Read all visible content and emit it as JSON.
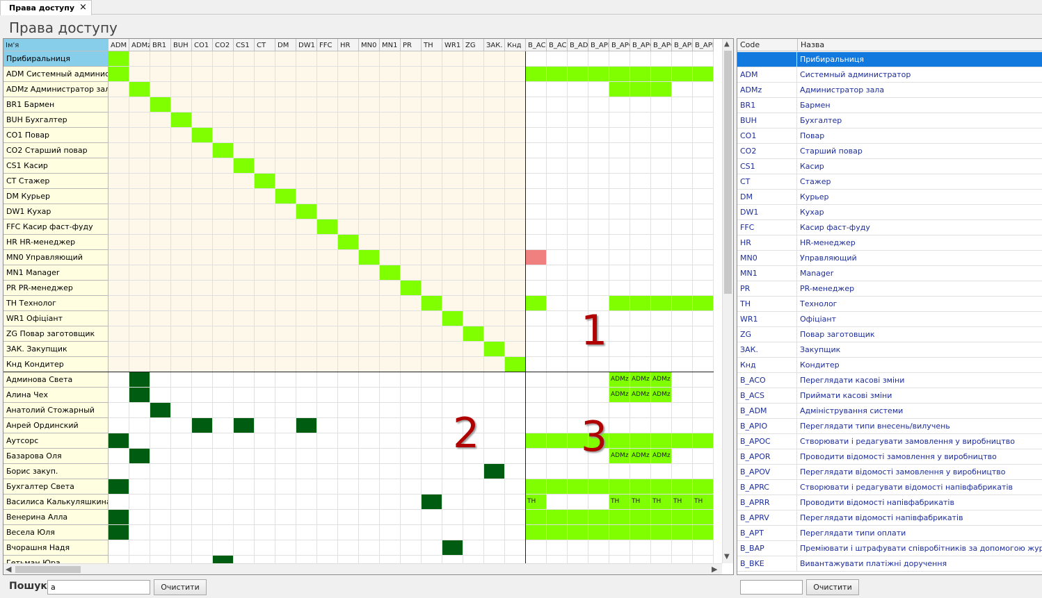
{
  "tab": {
    "title": "Права доступу",
    "close": "×"
  },
  "page_title": "Права доступу",
  "colors": {
    "light_green": "#7fff00",
    "dark_green": "#005c10",
    "pink": "#f08080",
    "cream": "#fdf8e9",
    "name_yellow": "#fffee0",
    "selected": "#1279de",
    "header_blue": "#87ceeb"
  },
  "matrix": {
    "name_header": "Ім'я",
    "columns": [
      "ADM",
      "ADMz",
      "BR1",
      "BUH",
      "CO1",
      "CO2",
      "CS1",
      "CT",
      "DM",
      "DW1",
      "FFC",
      "HR",
      "MN0",
      "MN1",
      "PR",
      "TH",
      "WR1",
      "ZG",
      "ЗАК.",
      "Кнд",
      "B_ACO",
      "B_ACS",
      "B_ADM",
      "B_APIO",
      "B_APOC",
      "B_APOR",
      "B_APOV",
      "B_APRC",
      "B_APRR"
    ],
    "roles": [
      "Прибиральниця",
      "ADM Системный администратор",
      "ADMz Администратор зала",
      "BR1 Бармен",
      "BUH Бухгалтер",
      "CO1 Повар",
      "CO2 Старший повар",
      "CS1 Касир",
      "CT Стажер",
      "DM Курьер",
      "DW1 Кухар",
      "FFC Касир фаст-фуду",
      "HR HR-менеджер",
      "MN0 Управляющий",
      "MN1 Manager",
      "PR PR-менеджер",
      "TH Технолог",
      "WR1 Офіціант",
      "ZG Повар заготовщик",
      "ЗАК. Закупщик",
      "Кнд Кондитер"
    ],
    "users": [
      "Админова Света",
      "Алина Чех",
      "Анатолий Стожарный",
      "Анрей Ординский",
      "Аутсорс",
      "Базарова Оля",
      "Борис закуп.",
      "Бухгалтер Света",
      "Василиса Калькуляшкина",
      "Венерина Алла",
      "Весела Юля",
      "Вчорашня Надя",
      "Гетьман Юра"
    ],
    "role_perm_cells": [
      [
        1,
        20
      ],
      [
        1,
        21
      ],
      [
        1,
        22
      ],
      [
        1,
        23
      ],
      [
        1,
        24
      ],
      [
        1,
        25
      ],
      [
        1,
        26
      ],
      [
        1,
        27
      ],
      [
        1,
        28
      ],
      [
        2,
        24
      ],
      [
        2,
        25
      ],
      [
        2,
        26
      ],
      [
        16,
        20
      ],
      [
        16,
        24
      ],
      [
        16,
        25
      ],
      [
        16,
        26
      ],
      [
        16,
        27
      ],
      [
        16,
        28
      ]
    ],
    "role_perm_pink": [
      [
        13,
        20
      ]
    ],
    "user_role_cells": [
      [
        0,
        1
      ],
      [
        1,
        1
      ],
      [
        2,
        2
      ],
      [
        3,
        4
      ],
      [
        3,
        6
      ],
      [
        3,
        9
      ],
      [
        4,
        0
      ],
      [
        5,
        1
      ],
      [
        6,
        18
      ],
      [
        7,
        0
      ],
      [
        8,
        15
      ],
      [
        9,
        0
      ],
      [
        10,
        0
      ],
      [
        11,
        16
      ],
      [
        12,
        5
      ]
    ],
    "user_perm_cells": [
      [
        0,
        24,
        "ADMz"
      ],
      [
        0,
        25,
        "ADMz"
      ],
      [
        0,
        26,
        "ADMz"
      ],
      [
        1,
        24,
        "ADMz"
      ],
      [
        1,
        25,
        "ADMz"
      ],
      [
        1,
        26,
        "ADMz"
      ],
      [
        4,
        20,
        ""
      ],
      [
        4,
        21,
        ""
      ],
      [
        4,
        22,
        ""
      ],
      [
        4,
        23,
        ""
      ],
      [
        4,
        24,
        ""
      ],
      [
        4,
        25,
        ""
      ],
      [
        4,
        26,
        ""
      ],
      [
        4,
        27,
        ""
      ],
      [
        4,
        28,
        ""
      ],
      [
        5,
        24,
        "ADMz"
      ],
      [
        5,
        25,
        "ADMz"
      ],
      [
        5,
        26,
        "ADMz"
      ],
      [
        7,
        20,
        ""
      ],
      [
        7,
        21,
        ""
      ],
      [
        7,
        22,
        ""
      ],
      [
        7,
        23,
        ""
      ],
      [
        7,
        24,
        ""
      ],
      [
        7,
        25,
        ""
      ],
      [
        7,
        26,
        ""
      ],
      [
        7,
        27,
        ""
      ],
      [
        7,
        28,
        ""
      ],
      [
        8,
        20,
        "TH"
      ],
      [
        8,
        24,
        "TH"
      ],
      [
        8,
        25,
        "TH"
      ],
      [
        8,
        26,
        "TH"
      ],
      [
        8,
        27,
        "TH"
      ],
      [
        8,
        28,
        "TH"
      ],
      [
        9,
        20,
        ""
      ],
      [
        9,
        21,
        ""
      ],
      [
        9,
        22,
        ""
      ],
      [
        9,
        23,
        ""
      ],
      [
        9,
        24,
        ""
      ],
      [
        9,
        25,
        ""
      ],
      [
        9,
        26,
        ""
      ],
      [
        9,
        27,
        ""
      ],
      [
        9,
        28,
        ""
      ],
      [
        10,
        20,
        ""
      ],
      [
        10,
        21,
        ""
      ],
      [
        10,
        22,
        ""
      ],
      [
        10,
        23,
        ""
      ],
      [
        10,
        24,
        ""
      ],
      [
        10,
        25,
        ""
      ],
      [
        10,
        26,
        ""
      ],
      [
        10,
        27,
        ""
      ],
      [
        10,
        28,
        ""
      ]
    ]
  },
  "annotations": [
    "1",
    "2",
    "3"
  ],
  "scroll": {
    "up": "▲",
    "down": "▼",
    "left": "◀",
    "right": "▶"
  },
  "right_table": {
    "headers": {
      "code": "Code",
      "name": "Назва"
    },
    "rows": [
      {
        "code": "",
        "name": "Прибиральниця"
      },
      {
        "code": "ADM",
        "name": "Системный администратор"
      },
      {
        "code": "ADMz",
        "name": "Администратор зала"
      },
      {
        "code": "BR1",
        "name": "Бармен"
      },
      {
        "code": "BUH",
        "name": "Бухгалтер"
      },
      {
        "code": "CO1",
        "name": "Повар"
      },
      {
        "code": "CO2",
        "name": "Старший повар"
      },
      {
        "code": "CS1",
        "name": "Касир"
      },
      {
        "code": "CT",
        "name": "Стажер"
      },
      {
        "code": "DM",
        "name": "Курьер"
      },
      {
        "code": "DW1",
        "name": "Кухар"
      },
      {
        "code": "FFC",
        "name": "Касир фаст-фуду"
      },
      {
        "code": "HR",
        "name": "HR-менеджер"
      },
      {
        "code": "MN0",
        "name": "Управляющий"
      },
      {
        "code": "MN1",
        "name": "Manager"
      },
      {
        "code": "PR",
        "name": "PR-менеджер"
      },
      {
        "code": "TH",
        "name": "Технолог"
      },
      {
        "code": "WR1",
        "name": "Офіціант"
      },
      {
        "code": "ZG",
        "name": "Повар заготовщик"
      },
      {
        "code": "ЗАК.",
        "name": "Закупщик"
      },
      {
        "code": "Кнд",
        "name": "Кондитер"
      },
      {
        "code": "B_ACO",
        "name": "Переглядати касові зміни"
      },
      {
        "code": "B_ACS",
        "name": "Приймати касові зміни"
      },
      {
        "code": "B_ADM",
        "name": "Адміністрування системи"
      },
      {
        "code": "B_APIO",
        "name": "Переглядати типи внесень/вилучень"
      },
      {
        "code": "B_APOC",
        "name": "Створювати і редагувати замовлення у виробництво"
      },
      {
        "code": "B_APOR",
        "name": "Проводити відомості замовлення у виробництво"
      },
      {
        "code": "B_APOV",
        "name": "Переглядати відомості замовлення у виробництво"
      },
      {
        "code": "B_APRC",
        "name": "Створювати і редагувати відомості напівфабрикатів"
      },
      {
        "code": "B_APRR",
        "name": "Проводити відомості напівфабрикатів"
      },
      {
        "code": "B_APRV",
        "name": "Переглядати відомості напівфабрикатів"
      },
      {
        "code": "B_APT",
        "name": "Переглядати типи оплати"
      },
      {
        "code": "B_BAP",
        "name": "Преміювати і штрафувати співробітників за допомогою журналів \""
      },
      {
        "code": "B_BKE",
        "name": "Вивантажувати платіжні доручення"
      }
    ]
  },
  "search": {
    "label": "Пошук",
    "value": "a",
    "clear": "Очистити",
    "clear_right": "Очистити",
    "right_value": ""
  }
}
